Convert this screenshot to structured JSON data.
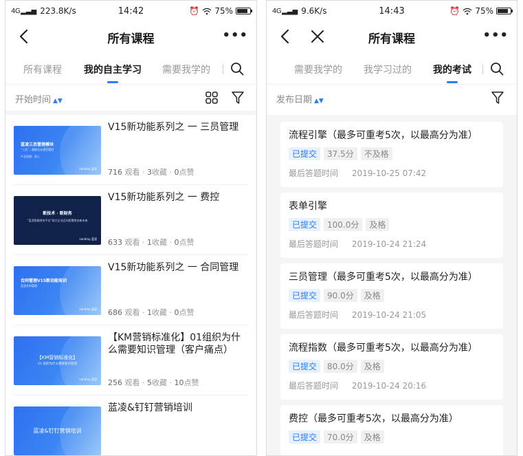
{
  "left": {
    "status": {
      "signal": "4G",
      "speed": "223.8K/s",
      "time": "14:42",
      "battery": "75%"
    },
    "nav": {
      "title": "所有课程"
    },
    "tabs": [
      "所有课程",
      "我的自主学习",
      "需要我学的"
    ],
    "sort_label": "开始时间",
    "courses": [
      {
        "title": "V15新功能系列之 一 三员管理",
        "views": "716",
        "views_unit": "观看",
        "fav": "3",
        "fav_unit": "收藏",
        "likes": "0",
        "likes_unit": "点赞",
        "thumb": {
          "style": "blue",
          "t1": "蓝凌三员管理模块",
          "t2": "“三员”，赋能企业规范管控",
          "t3": "产品经理：张三",
          "brand": "Landray 蓝凌"
        }
      },
      {
        "title": "V15新功能系列之 一 费控",
        "views": "633",
        "views_unit": "观看",
        "fav": "1",
        "fav_unit": "收藏",
        "likes": "0",
        "likes_unit": "点赞",
        "thumb": {
          "style": "navy",
          "t1": "新技术 · 新财务",
          "t2": "“蓝凌智能财务平台”助力企业迈向智慧财务新未来",
          "t3": "",
          "brand": "Landray 蓝凌"
        }
      },
      {
        "title": "V15新功能系列之 一 合同管理",
        "views": "686",
        "views_unit": "观看",
        "fav": "1",
        "fav_unit": "收藏",
        "likes": "0",
        "likes_unit": "点赞",
        "thumb": {
          "style": "blue",
          "t1": "合同管理V15新功能培训",
          "t2": "蓝凌合同管理",
          "t3": "",
          "brand": "Landray 蓝凌"
        }
      },
      {
        "title": "【KM营销标准化】01组织为什么需要知识管理（客户痛点）",
        "views": "256",
        "views_unit": "观看",
        "fav": "5",
        "fav_unit": "收藏",
        "likes": "10",
        "likes_unit": "点赞",
        "thumb": {
          "style": "blue",
          "t1": "【KM营销标准化】",
          "t2": "01 组织为什么需要知识管理",
          "t3": "",
          "brand": "Landray 蓝凌"
        }
      },
      {
        "title": "蓝凌&钉钉营销培训",
        "views": "",
        "views_unit": "",
        "fav": "",
        "fav_unit": "",
        "likes": "",
        "likes_unit": "",
        "thumb": {
          "style": "blue",
          "t1": "蓝凌&钉钉营销培训",
          "t2": "",
          "t3": "",
          "brand": ""
        }
      }
    ]
  },
  "right": {
    "status": {
      "signal": "4G",
      "speed": "9.6K/s",
      "time": "14:43",
      "battery": "75%"
    },
    "nav": {
      "title": "所有课程"
    },
    "tabs": [
      "需要我学的",
      "我学习过的",
      "我的考试"
    ],
    "sort_label": "发布日期",
    "exams": [
      {
        "title": "流程引擎（最多可重考5次，以最高分为准）",
        "status": "已提交",
        "score": "37.5分",
        "result": "不及格",
        "date_label": "最后答题时间",
        "date": "2019-10-25 07:42"
      },
      {
        "title": "表单引擎",
        "status": "已提交",
        "score": "100.0分",
        "result": "及格",
        "date_label": "最后答题时间",
        "date": "2019-10-24 21:24"
      },
      {
        "title": "三员管理（最多可重考5次，以最高分为准）",
        "status": "已提交",
        "score": "90.0分",
        "result": "及格",
        "date_label": "最后答题时间",
        "date": "2019-10-24 21:05"
      },
      {
        "title": "流程指数（最多可重考5次，以最高分为准）",
        "status": "已提交",
        "score": "80.0分",
        "result": "及格",
        "date_label": "最后答题时间",
        "date": "2019-10-24 20:16"
      },
      {
        "title": "费控（最多可重考5次，以最高分为准）",
        "status": "已提交",
        "score": "70.0分",
        "result": "及格",
        "date_label": "最后答题时间",
        "date": ""
      }
    ]
  },
  "colors": {
    "accent": "#2b7cf6",
    "tag_bg_blue": "#e8f1fe",
    "tag_bg_grey": "#f0f0f0",
    "page_grey": "#f5f5f5"
  }
}
